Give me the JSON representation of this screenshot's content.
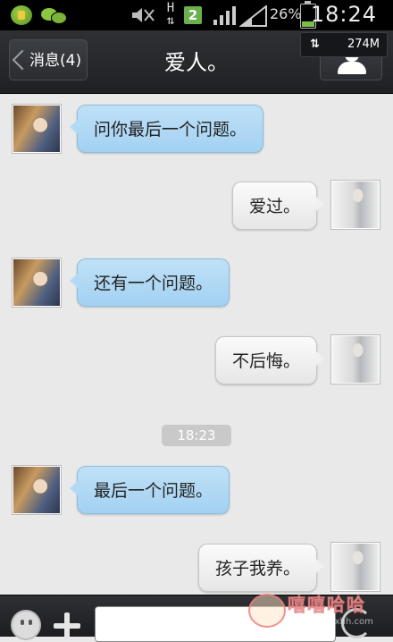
{
  "status_bar": {
    "app_icons": [
      "app-notification-icon",
      "wechat-icon"
    ],
    "network_type": "H",
    "sim_badge": "2",
    "battery_percent": "26%",
    "battery_level": 0.26,
    "time": "18:24"
  },
  "header": {
    "back_label": "消息(4)",
    "title": "爱人。",
    "traffic_arrows": "⇅",
    "traffic_value": "274M",
    "profile_icon": "user-profile-icon"
  },
  "messages": [
    {
      "side": "left",
      "text": "问你最后一个问题。"
    },
    {
      "side": "right",
      "text": "爱过。"
    },
    {
      "side": "left",
      "text": "还有一个问题。"
    },
    {
      "side": "right",
      "text": "不后悔。"
    },
    {
      "side": "left",
      "text": "最后一个问题。"
    },
    {
      "side": "right",
      "text": "孩子我养。"
    }
  ],
  "timestamp": "18:23",
  "input_bar": {
    "emoji_icon": "emoji-icon",
    "plus_icon": "plus-icon",
    "input_value": "",
    "voice_icon": "voice-icon"
  },
  "watermark": {
    "text": "嘻嘻哈哈",
    "url": "www.xxhh.com"
  },
  "colors": {
    "bar_background": "#26282b",
    "incoming_bubble": "#b3daf5",
    "outgoing_bubble": "#f0f0f0",
    "chat_background": "#e9e9e9",
    "battery_green": "#7ac043"
  }
}
